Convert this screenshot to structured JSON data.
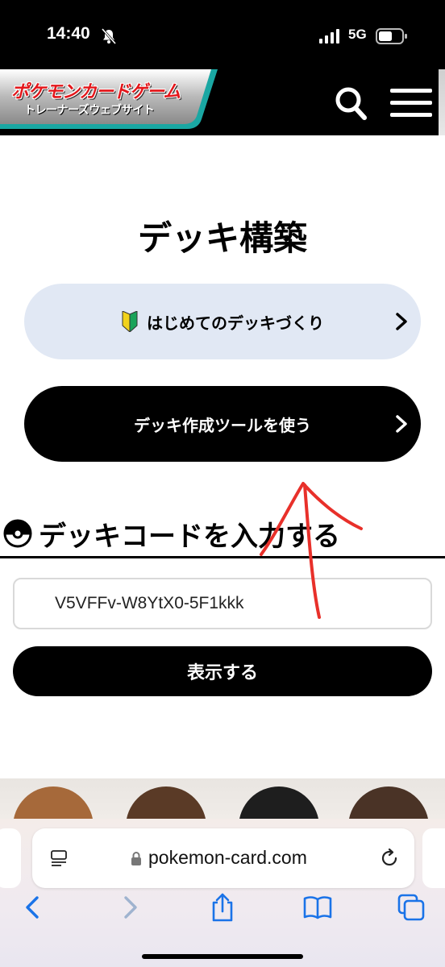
{
  "status_bar": {
    "time": "14:40",
    "network": "5G"
  },
  "header": {
    "logo_line1": "ポケモンカードゲーム",
    "logo_line2": "トレーナーズウェブサイト"
  },
  "main": {
    "title": "デッキ構築",
    "beginner_button": "はじめてのデッキづくり",
    "tool_button": "デッキ作成ツールを使う",
    "section_heading": "デッキコードを入力する",
    "deck_code_value": "V5VFFv-W8YtX0-5F1kkk",
    "show_button": "表示する"
  },
  "browser": {
    "url": "pokemon-card.com"
  },
  "colors": {
    "beginner_bg": "#e1e8f4",
    "annotation": "#e8302a",
    "logo_red": "#e3171b",
    "logo_teal": "#1aa7a3"
  }
}
